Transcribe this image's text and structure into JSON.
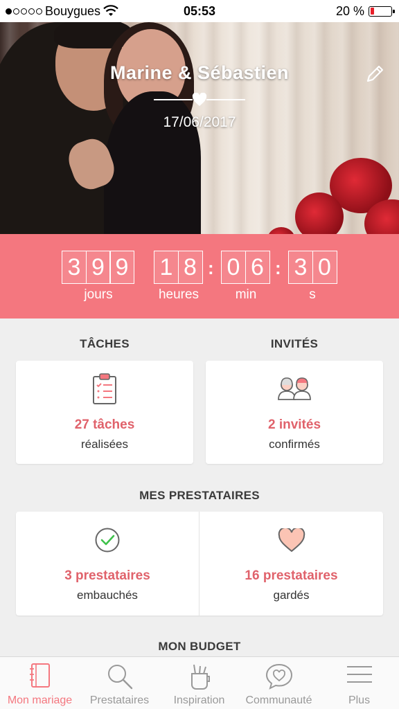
{
  "status_bar": {
    "carrier": "Bouygues",
    "time": "05:53",
    "battery_percent": "20 %",
    "battery_level": 0.2,
    "signal_bars": 1
  },
  "hero": {
    "title": "Marine & Sébastien",
    "date": "17/06/2017"
  },
  "countdown": {
    "days": [
      "3",
      "9",
      "9"
    ],
    "hours": [
      "1",
      "8"
    ],
    "minutes": [
      "0",
      "6"
    ],
    "seconds": [
      "3",
      "0"
    ],
    "labels": {
      "days": "jours",
      "hours": "heures",
      "minutes": "min",
      "seconds": "s"
    }
  },
  "tasks": {
    "title": "TÂCHES",
    "value": "27 tâches",
    "sub": "réalisées"
  },
  "guests": {
    "title": "INVITÉS",
    "value": "2 invités",
    "sub": "confirmés"
  },
  "vendors": {
    "title": "MES PRESTATAIRES",
    "hired": {
      "value": "3 prestataires",
      "sub": "embauchés"
    },
    "saved": {
      "value": "16 prestataires",
      "sub": "gardés"
    }
  },
  "budget": {
    "title": "MON BUDGET"
  },
  "tabs": [
    {
      "label": "Mon mariage",
      "icon": "notebook-icon",
      "active": true
    },
    {
      "label": "Prestataires",
      "icon": "search-icon",
      "active": false
    },
    {
      "label": "Inspiration",
      "icon": "pencil-cup-icon",
      "active": false
    },
    {
      "label": "Communauté",
      "icon": "chat-heart-icon",
      "active": false
    },
    {
      "label": "Plus",
      "icon": "menu-icon",
      "active": false
    }
  ],
  "colors": {
    "accent": "#f4777f",
    "value_text": "#e0626b",
    "background": "#efefef"
  }
}
